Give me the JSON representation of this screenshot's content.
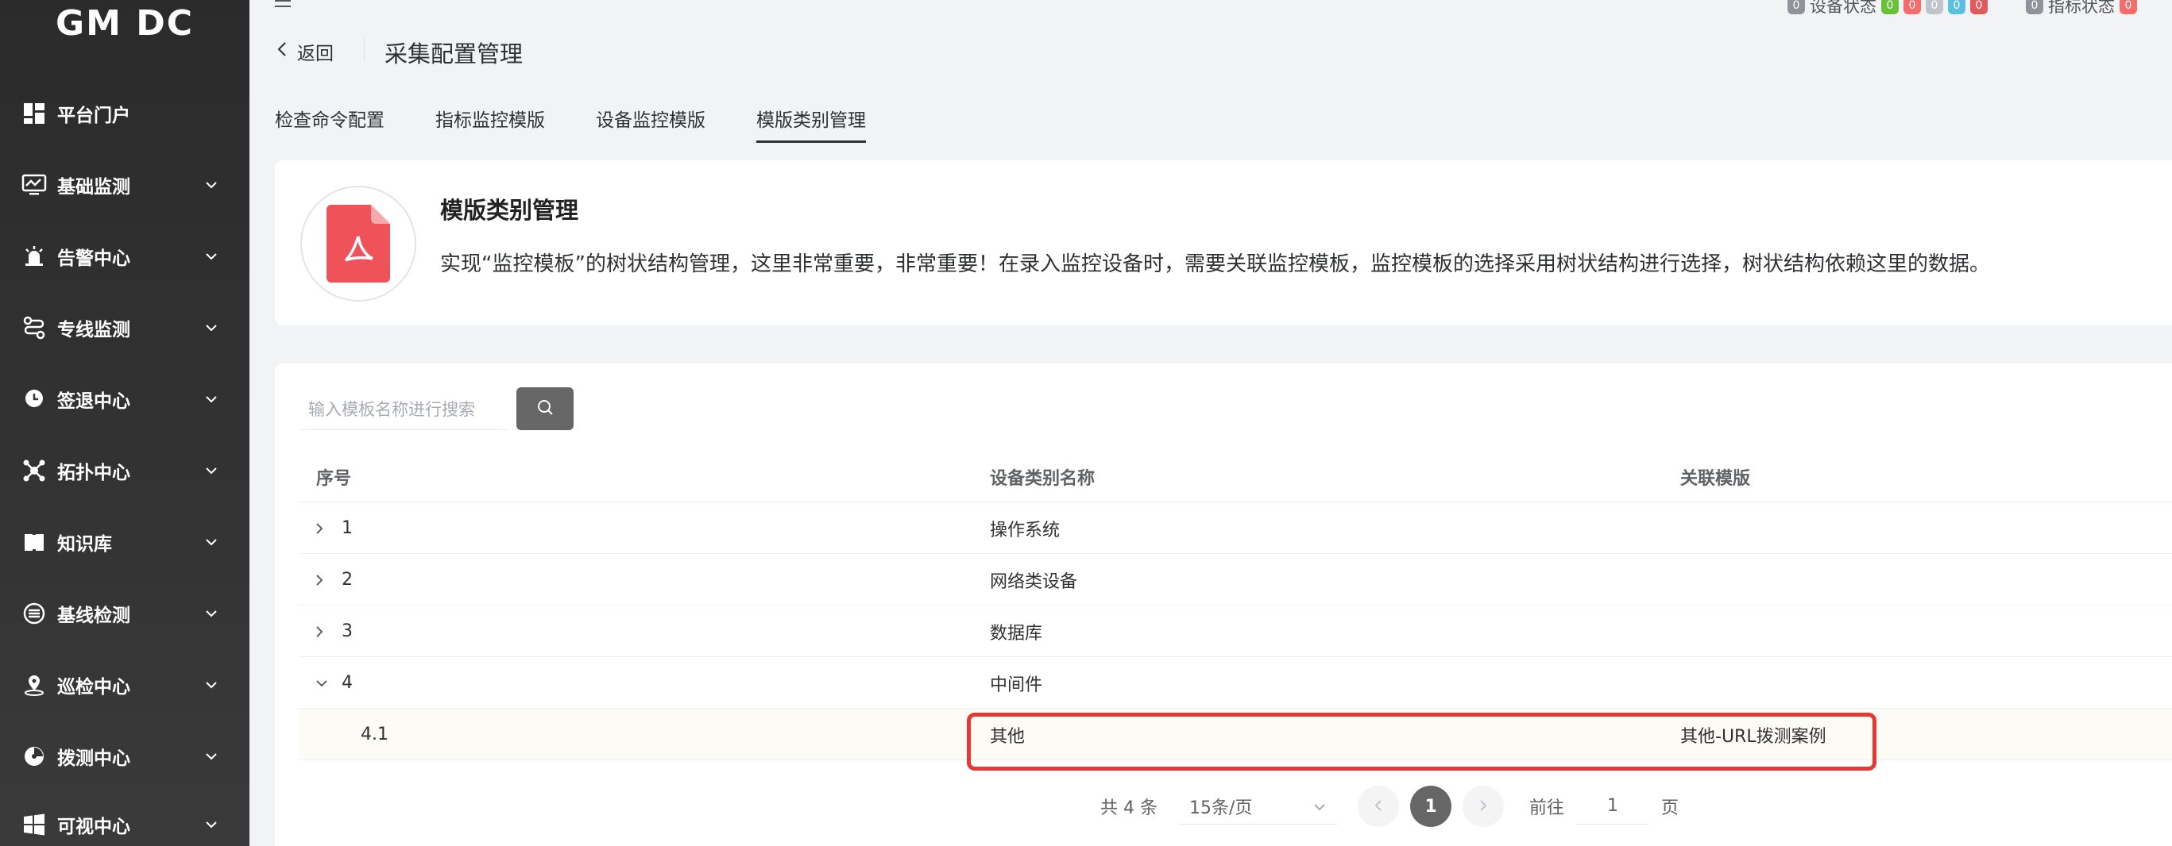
{
  "app": {
    "logo": "GM DC"
  },
  "sidebar": {
    "items": [
      {
        "label": "平台门户",
        "icon": "dashboard-icon",
        "has_children": false
      },
      {
        "label": "基础监测",
        "icon": "monitor-icon",
        "has_children": true
      },
      {
        "label": "告警中心",
        "icon": "alarm-icon",
        "has_children": true
      },
      {
        "label": "专线监测",
        "icon": "route-icon",
        "has_children": true
      },
      {
        "label": "签退中心",
        "icon": "pin-icon",
        "has_children": true
      },
      {
        "label": "拓扑中心",
        "icon": "topology-icon",
        "has_children": true
      },
      {
        "label": "知识库",
        "icon": "book-icon",
        "has_children": true
      },
      {
        "label": "基线检测",
        "icon": "baseline-icon",
        "has_children": true
      },
      {
        "label": "巡检中心",
        "icon": "location-icon",
        "has_children": true
      },
      {
        "label": "拨测中心",
        "icon": "probe-icon",
        "has_children": true
      },
      {
        "label": "可视中心",
        "icon": "windows-icon",
        "has_children": true
      }
    ]
  },
  "header": {
    "back_label": "返回",
    "title": "采集配置管理",
    "status": {
      "device_label": "设备状态",
      "device_badges": [
        {
          "value": "0",
          "color": "#909399"
        },
        {
          "value": "0",
          "color": "#67c23a"
        },
        {
          "value": "0",
          "color": "#f56c6c"
        },
        {
          "value": "0",
          "color": "#c0c4cc"
        },
        {
          "value": "0",
          "color": "#5bc0de"
        },
        {
          "value": "0",
          "color": "#e05a5a"
        }
      ],
      "metric_label": "指标状态",
      "metric_badges": [
        {
          "value": "0",
          "color": "#909399"
        },
        {
          "value": "0",
          "color": "#f56c6c"
        }
      ]
    }
  },
  "tabs": [
    {
      "label": "检查命令配置",
      "active": false
    },
    {
      "label": "指标监控模版",
      "active": false
    },
    {
      "label": "设备监控模版",
      "active": false
    },
    {
      "label": "模版类别管理",
      "active": true
    }
  ],
  "info": {
    "title": "模版类别管理",
    "description": "实现“监控模板”的树状结构管理，这里非常重要，非常重要！在录入监控设备时，需要关联监控模板，监控模板的选择采用树状结构进行选择，树状结构依赖这里的数据。"
  },
  "search": {
    "placeholder": "输入模板名称进行搜索",
    "value": ""
  },
  "table": {
    "headers": [
      "序号",
      "设备类别名称",
      "关联模版"
    ],
    "rows": [
      {
        "index": "1",
        "name": "操作系统",
        "template": "",
        "expanded": false,
        "child": false
      },
      {
        "index": "2",
        "name": "网络类设备",
        "template": "",
        "expanded": false,
        "child": false
      },
      {
        "index": "3",
        "name": "数据库",
        "template": "",
        "expanded": false,
        "child": false
      },
      {
        "index": "4",
        "name": "中间件",
        "template": "",
        "expanded": true,
        "child": false
      },
      {
        "index": "4.1",
        "name": "其他",
        "template": "其他-URL拨测案例",
        "expanded": false,
        "child": true
      }
    ]
  },
  "pagination": {
    "total_label": "共 4 条",
    "page_size": "15条/页",
    "current_page": "1",
    "goto_label": "前往",
    "goto_value": "1",
    "page_suffix": "页"
  }
}
